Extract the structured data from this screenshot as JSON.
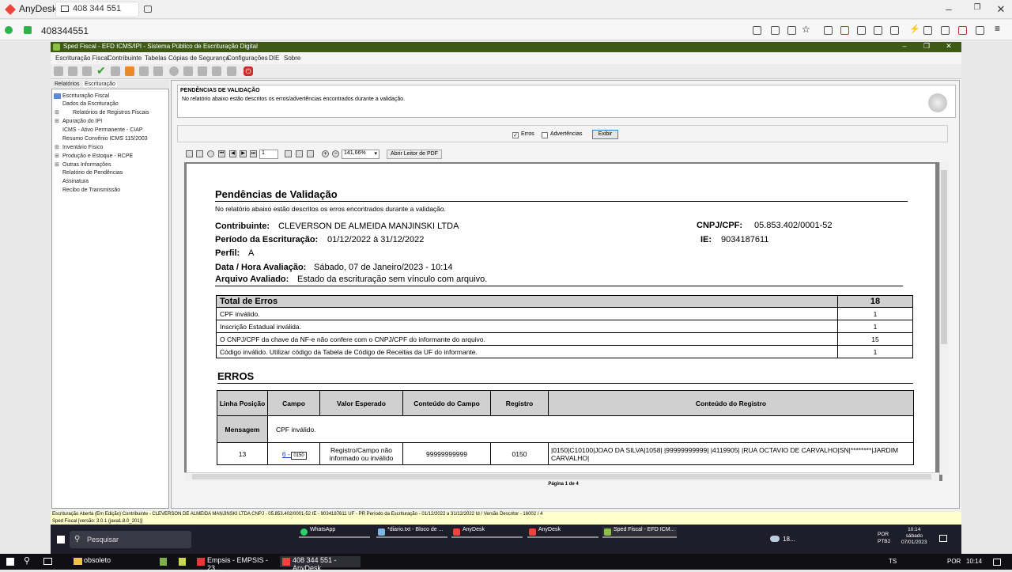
{
  "anydesk": {
    "app_name": "AnyDesk",
    "tab_label": "408 344 551",
    "address": "408344551"
  },
  "sped": {
    "title": "Sped Fiscal - EFD ICMS/IPI - Sistema Público de Escrituração Digital",
    "menu": [
      "Escrituração Fiscal",
      "Contribuinte",
      "Tabelas",
      "Cópias de Segurança",
      "Configurações",
      "DIE",
      "Sobre"
    ],
    "left_tabs": [
      "Relatórios",
      "Escrituração"
    ],
    "tree": [
      "Escrituração Fiscal",
      "Dados da Escrituração",
      "Relatórios de Registros Fiscais",
      "Apuração do IPI",
      "ICMS - Ativo Permanente - CIAP",
      "Resumo  Convênio ICMS 115/2003",
      "Inventário Físico",
      "Produção e Estoque - RCPE",
      "Outras Informações",
      "Relatório de Pendências",
      "Assinatura",
      "Recibo de Transmissão"
    ],
    "pend_title": "PENDÊNCIAS DE VALIDAÇÃO",
    "pend_desc": "No relatório abaixo estão descritos os erros/advertências encontrados durante a validação.",
    "filter": {
      "erros": "Erros",
      "advertencias": "Advertências",
      "exibir": "Exibir"
    },
    "pdf": {
      "page": "1",
      "zoom": "141,66%",
      "open_pdf": "Abrir Leitor de PDF",
      "page_status": "Página 1 de 4"
    },
    "status1": "Escrituração Aberta (Em Edição) Contribuinte - CLEVERSON DE ALMEIDA MANJINSKI LTDA CNPJ - 05.853.402/0001-52 IE - 9034187611 UF - PR Período da Escrituração - 01/12/2022 a 31/12/2022 Id / Versão Descritor - 16002 / 4",
    "status2": "Sped Fiscal [versão: 3.0.1 (java1.8.0_201)]"
  },
  "report": {
    "title": "Pendências de Validação",
    "subtitle": "No relatório abaixo estão descritos os erros encontrados durante a validação.",
    "contribuinte_label": "Contribuinte:",
    "contribuinte": "CLEVERSON DE ALMEIDA MANJINSKI LTDA",
    "cnpj_label": "CNPJ/CPF:",
    "cnpj": "05.853.402/0001-52",
    "periodo_label": "Período da Escrituração:",
    "periodo": "01/12/2022 à  31/12/2022",
    "ie_label": "IE:",
    "ie": "9034187611",
    "perfil_label": "Perfil:",
    "perfil": "A",
    "data_label": "Data / Hora Avaliação:",
    "data": "Sábado, 07 de Janeiro/2023 - 10:14",
    "arquivo_label": "Arquivo Avaliado:",
    "arquivo": "Estado da escrituração sem vínculo com arquivo.",
    "total_label": "Total de Erros",
    "total": "18",
    "totals": [
      {
        "desc": "CPF inválido.",
        "count": "1"
      },
      {
        "desc": "Inscrição Estadual inválida.",
        "count": "1"
      },
      {
        "desc": "O CNPJ/CPF da chave da NF-e não confere com o CNPJ/CPF do informante do arquivo.",
        "count": "15"
      },
      {
        "desc": "Código inválido. Utilizar código da Tabela de Código de Receitas da UF do informante.",
        "count": "1"
      }
    ],
    "errors_title": "ERROS",
    "headers": [
      "Linha Posição",
      "Campo",
      "Valor Esperado",
      "Conteúdo do Campo",
      "Registro",
      "Conteúdo do Registro"
    ],
    "msg_label": "Mensagem",
    "msg": "CPF inválido.",
    "row": {
      "linha": "13",
      "campo": "6 - CPF",
      "tooltip": "0150",
      "valor": "Registro/Campo não informado ou inválido",
      "conteudo": "99999999999",
      "registro": "0150",
      "reg_conteudo": "|0150|C10100|JOAO DA SILVA|1058| |99999999999| |4119905| |RUA OCTAVIO DE CARVALHO|SN|********|JARDIM CARVALHO|"
    }
  },
  "remote_taskbar": {
    "search": "Pesquisar",
    "apps": [
      "WhatsApp",
      "*diario.txt - Bloco de ...",
      "AnyDesk",
      "AnyDesk",
      "Sped Fiscal - EFD ICM..."
    ],
    "weather": "18...",
    "lang": "POR PTB2",
    "time": "10:14",
    "day": "sábado",
    "date": "07/01/2023"
  },
  "local_taskbar": {
    "apps": [
      "obsoleto",
      "Empsis - EMPSIS - 23....",
      "408 344 551 - AnyDesk"
    ],
    "ts": "TS",
    "lang": "POR",
    "time": "10:14"
  }
}
